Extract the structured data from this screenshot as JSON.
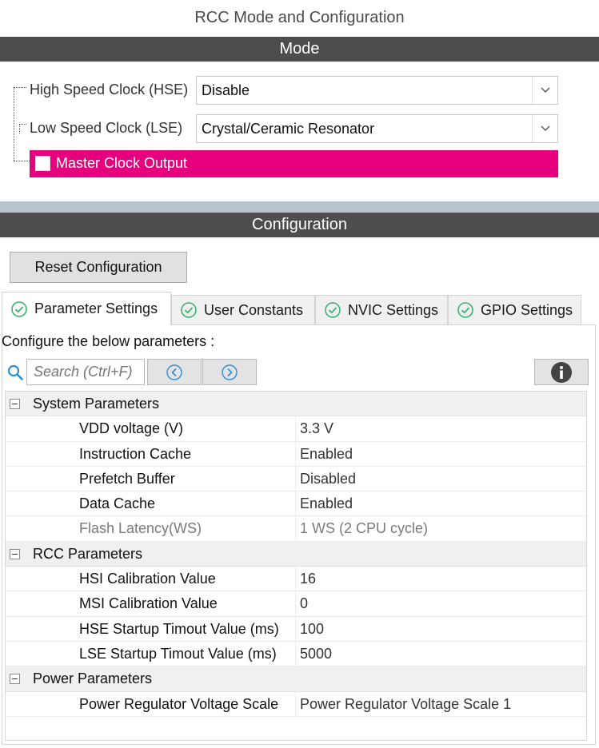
{
  "window": {
    "title": "RCC Mode and Configuration"
  },
  "mode": {
    "header": "Mode",
    "hse": {
      "label": "High Speed Clock (HSE)",
      "value": "Disable"
    },
    "lse": {
      "label": "Low Speed Clock (LSE)",
      "value": "Crystal/Ceramic Resonator"
    },
    "mco": {
      "label": "Master Clock Output",
      "checked": false,
      "highlight_color": "#e6007e"
    }
  },
  "configuration": {
    "header": "Configuration",
    "reset_label": "Reset Configuration",
    "tabs": [
      {
        "label": "Parameter Settings",
        "icon": "check-circle-icon",
        "active": true
      },
      {
        "label": "User Constants",
        "icon": "check-circle-icon",
        "active": false
      },
      {
        "label": "NVIC Settings",
        "icon": "check-circle-icon",
        "active": false
      },
      {
        "label": "GPIO Settings",
        "icon": "check-circle-icon",
        "active": false
      }
    ],
    "instructions": "Configure the below parameters :",
    "search": {
      "placeholder": "Search (Ctrl+F)",
      "value": ""
    },
    "groups": [
      {
        "name": "System Parameters",
        "params": [
          {
            "name": "VDD voltage (V)",
            "value": "3.3 V"
          },
          {
            "name": "Instruction Cache",
            "value": "Enabled"
          },
          {
            "name": "Prefetch Buffer",
            "value": "Disabled"
          },
          {
            "name": "Data Cache",
            "value": "Enabled"
          },
          {
            "name": "Flash Latency(WS)",
            "value": "1 WS (2 CPU cycle)",
            "disabled": true
          }
        ]
      },
      {
        "name": "RCC Parameters",
        "params": [
          {
            "name": "HSI Calibration Value",
            "value": "16"
          },
          {
            "name": "MSI Calibration Value",
            "value": "0"
          },
          {
            "name": "HSE Startup Timout Value (ms)",
            "value": "100"
          },
          {
            "name": "LSE Startup Timout Value (ms)",
            "value": "5000"
          }
        ]
      },
      {
        "name": "Power Parameters",
        "params": [
          {
            "name": "Power Regulator Voltage Scale",
            "value": "Power Regulator Voltage Scale 1"
          }
        ]
      }
    ]
  },
  "colors": {
    "section_bar": "#4d4d4d",
    "accent": "#e6007e",
    "tab_check": "#3cb371",
    "nav_arrow": "#2a8fd6"
  }
}
